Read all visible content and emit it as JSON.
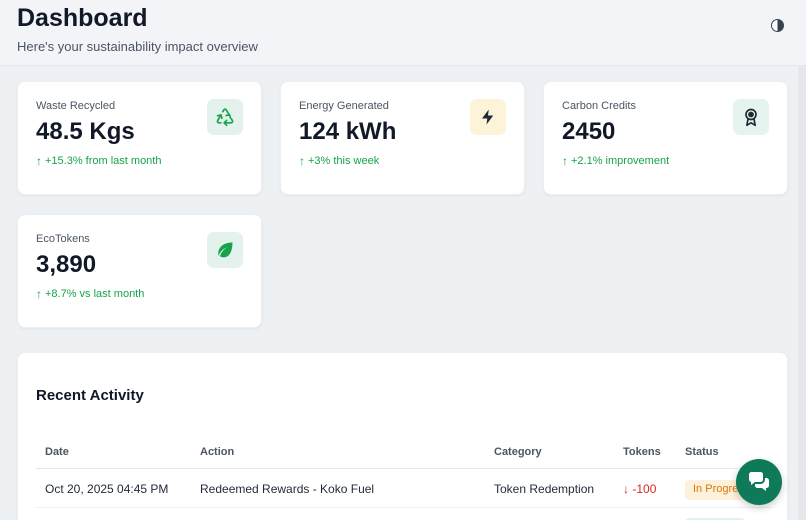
{
  "header": {
    "title": "Dashboard",
    "subtitle": "Here's your sustainability impact overview",
    "theme_toggle_icon": "contrast-icon"
  },
  "stats": [
    {
      "label": "Waste Recycled",
      "value": "48.5 Kgs",
      "change": "+15.3% from last month",
      "icon": "recycle-icon",
      "icon_color": "#16a34a"
    },
    {
      "label": "Energy Generated",
      "value": "124 kWh",
      "change": "+3% this week",
      "icon": "lightning-icon",
      "icon_color": "#1f2937"
    },
    {
      "label": "Carbon Credits",
      "value": "2450",
      "change": "+2.1% improvement",
      "icon": "award-badge-icon",
      "icon_color": "#1f2937"
    },
    {
      "label": "EcoTokens",
      "value": "3,890",
      "change": "+8.7% vs last month",
      "icon": "leaf-icon",
      "icon_color": "#16a34a"
    }
  ],
  "activity": {
    "title": "Recent Activity",
    "columns": [
      "Date",
      "Action",
      "Category",
      "Tokens",
      "Status"
    ],
    "rows": [
      {
        "date": "Oct 20, 2025 04:45 PM",
        "action": "Redeemed Rewards - Koko Fuel",
        "category": "Token Redemption",
        "tokens": "-100",
        "status": "In Progress"
      }
    ]
  },
  "colors": {
    "accent": "#0f7a5a",
    "positive": "#16a34a",
    "negative": "#dc2626",
    "pending": "#d97706"
  },
  "chat": {
    "icon": "chat-bubbles-icon"
  }
}
